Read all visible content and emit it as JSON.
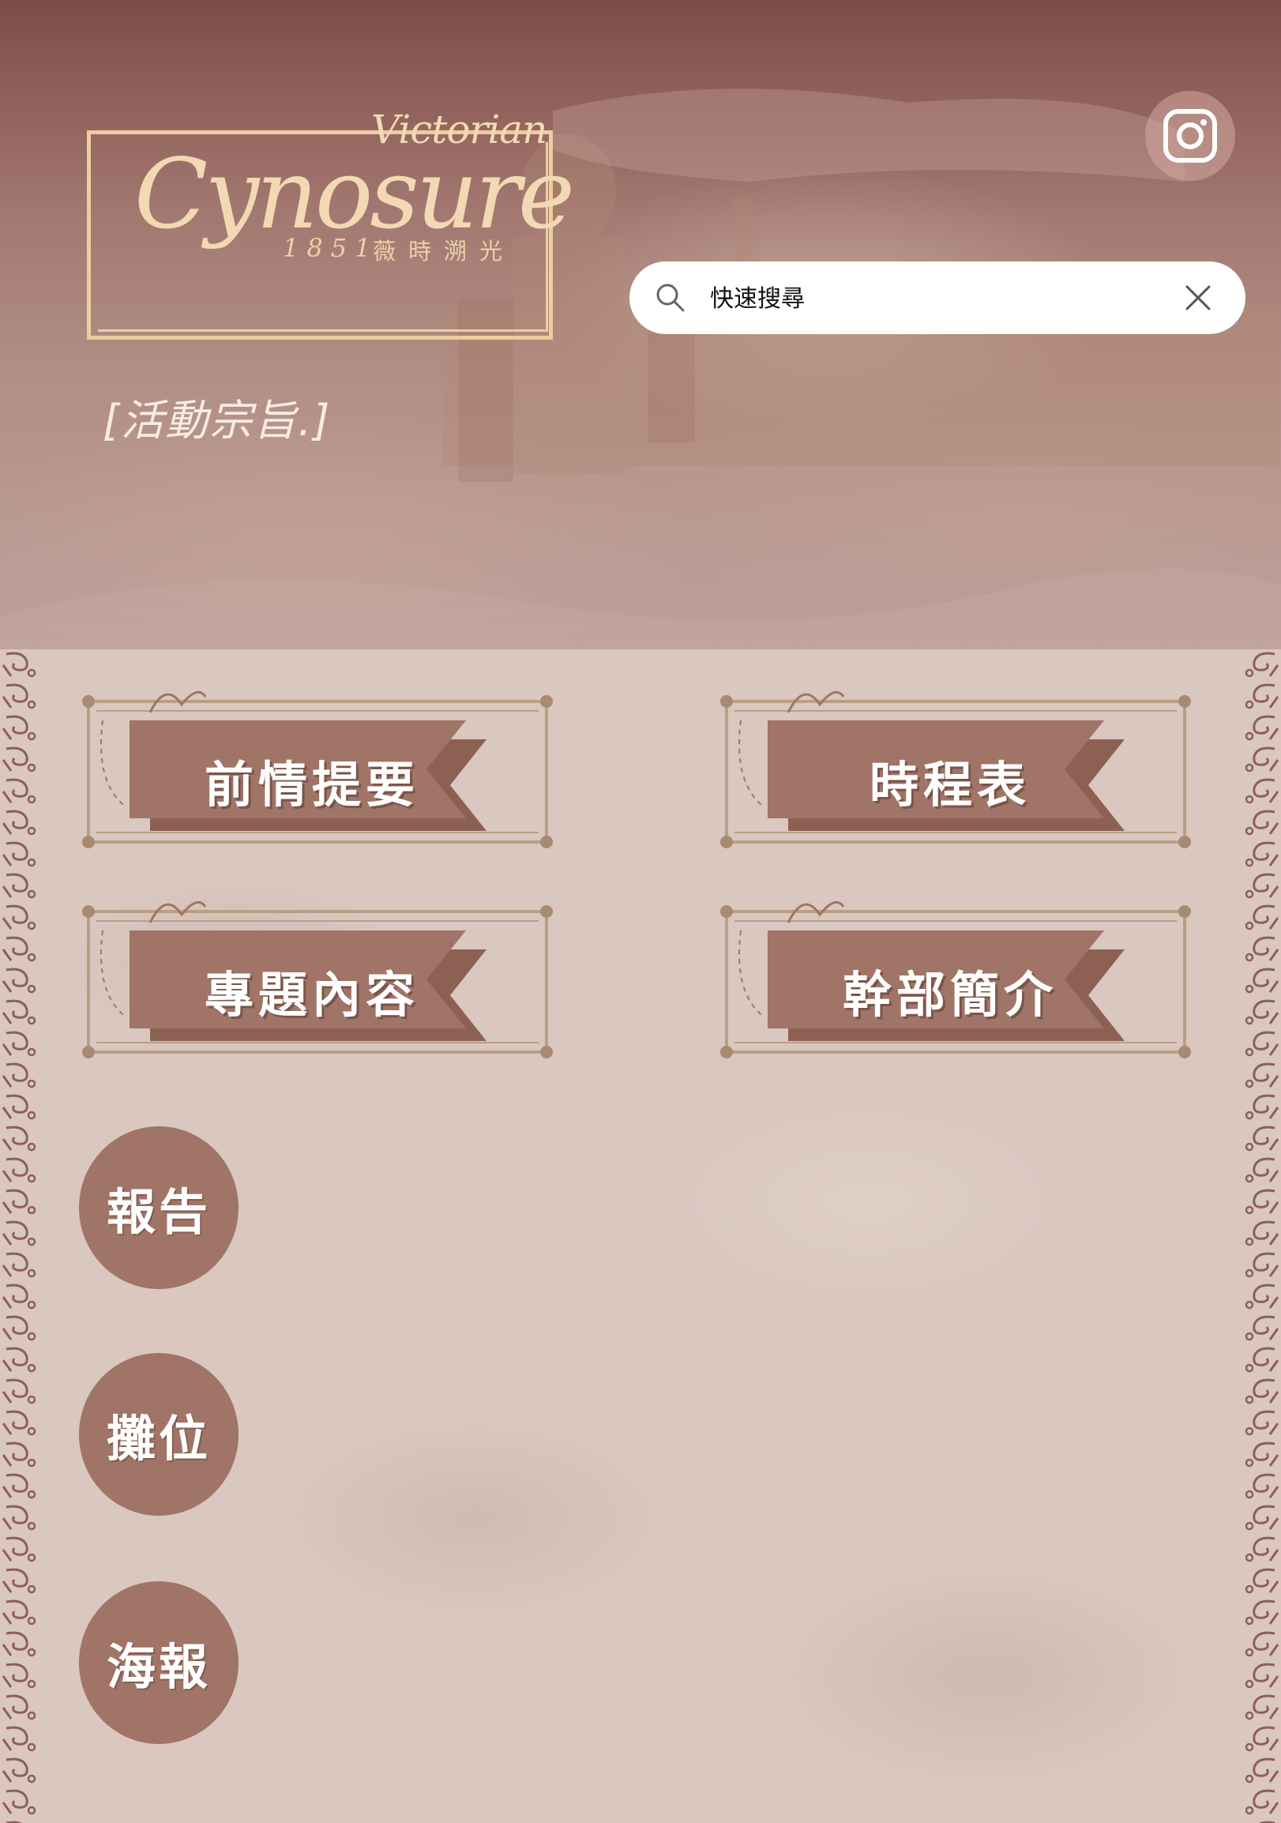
{
  "header": {
    "logo": {
      "script_small": "Victorian",
      "script_large": "Cynosure",
      "year": "1851",
      "subtitle": "薇時溯光"
    },
    "tagline": "[活動宗旨.]",
    "instagram_icon": "instagram-icon",
    "search": {
      "placeholder": "快速搜尋",
      "value": "",
      "search_icon": "search-icon",
      "clear_icon": "close-icon"
    }
  },
  "menu": {
    "banners": [
      {
        "label": "前情提要"
      },
      {
        "label": "時程表"
      },
      {
        "label": "專題內容"
      },
      {
        "label": "幹部簡介"
      }
    ],
    "circles": [
      {
        "label": "報告"
      },
      {
        "label": "攤位"
      },
      {
        "label": "海報"
      }
    ]
  },
  "colors": {
    "banner_fill": "#a07466",
    "frame_line": "#b89f86",
    "border_ornament": "#8e5d5a",
    "logo_gold": "#f2d9b4"
  }
}
